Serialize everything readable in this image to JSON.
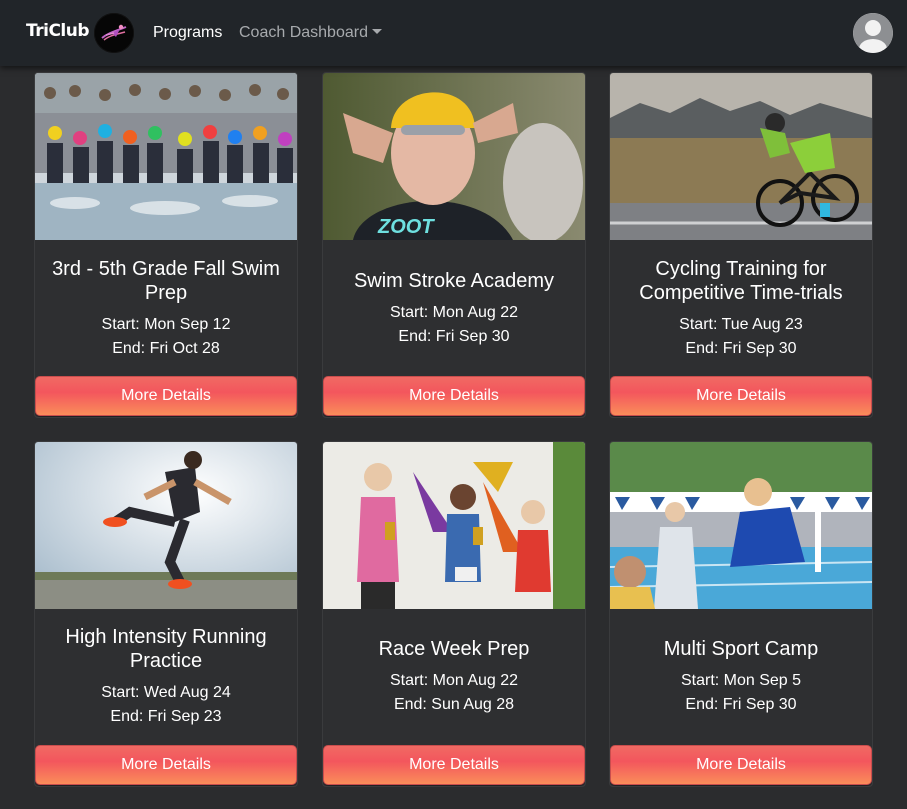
{
  "nav": {
    "brand": "TriClub",
    "links": [
      {
        "label": "Programs"
      },
      {
        "label": "Coach Dashboard"
      }
    ]
  },
  "programs": [
    {
      "title": "3rd - 5th Grade Fall Swim Prep",
      "start": "Start: Mon Sep 12",
      "end": "End: Fri Oct 28",
      "button": "More Details"
    },
    {
      "title": "Swim Stroke Academy",
      "start": "Start: Mon Aug 22",
      "end": "End: Fri Sep 30",
      "button": "More Details"
    },
    {
      "title": "Cycling Training for Competitive Time-trials",
      "start": "Start: Tue Aug 23",
      "end": "End: Fri Sep 30",
      "button": "More Details"
    },
    {
      "title": "High Intensity Running Practice",
      "start": "Start: Wed Aug 24",
      "end": "End: Fri Sep 23",
      "button": "More Details"
    },
    {
      "title": "Race Week Prep",
      "start": "Start: Mon Aug 22",
      "end": "End: Sun Aug 28",
      "button": "More Details"
    },
    {
      "title": "Multi Sport Camp",
      "start": "Start: Mon Sep 5",
      "end": "End: Fri Sep 30",
      "button": "More Details"
    }
  ],
  "colors": {
    "navbar": "#212529",
    "page_background": "#2b2c2e",
    "card_background": "#2e2f31",
    "button_gradient_start": "#f3565d",
    "button_gradient_end": "#fa8d5a"
  },
  "icons": {
    "logo": "triathlete-logo-icon",
    "avatar": "user-avatar-icon",
    "dropdown": "caret-down-icon"
  }
}
